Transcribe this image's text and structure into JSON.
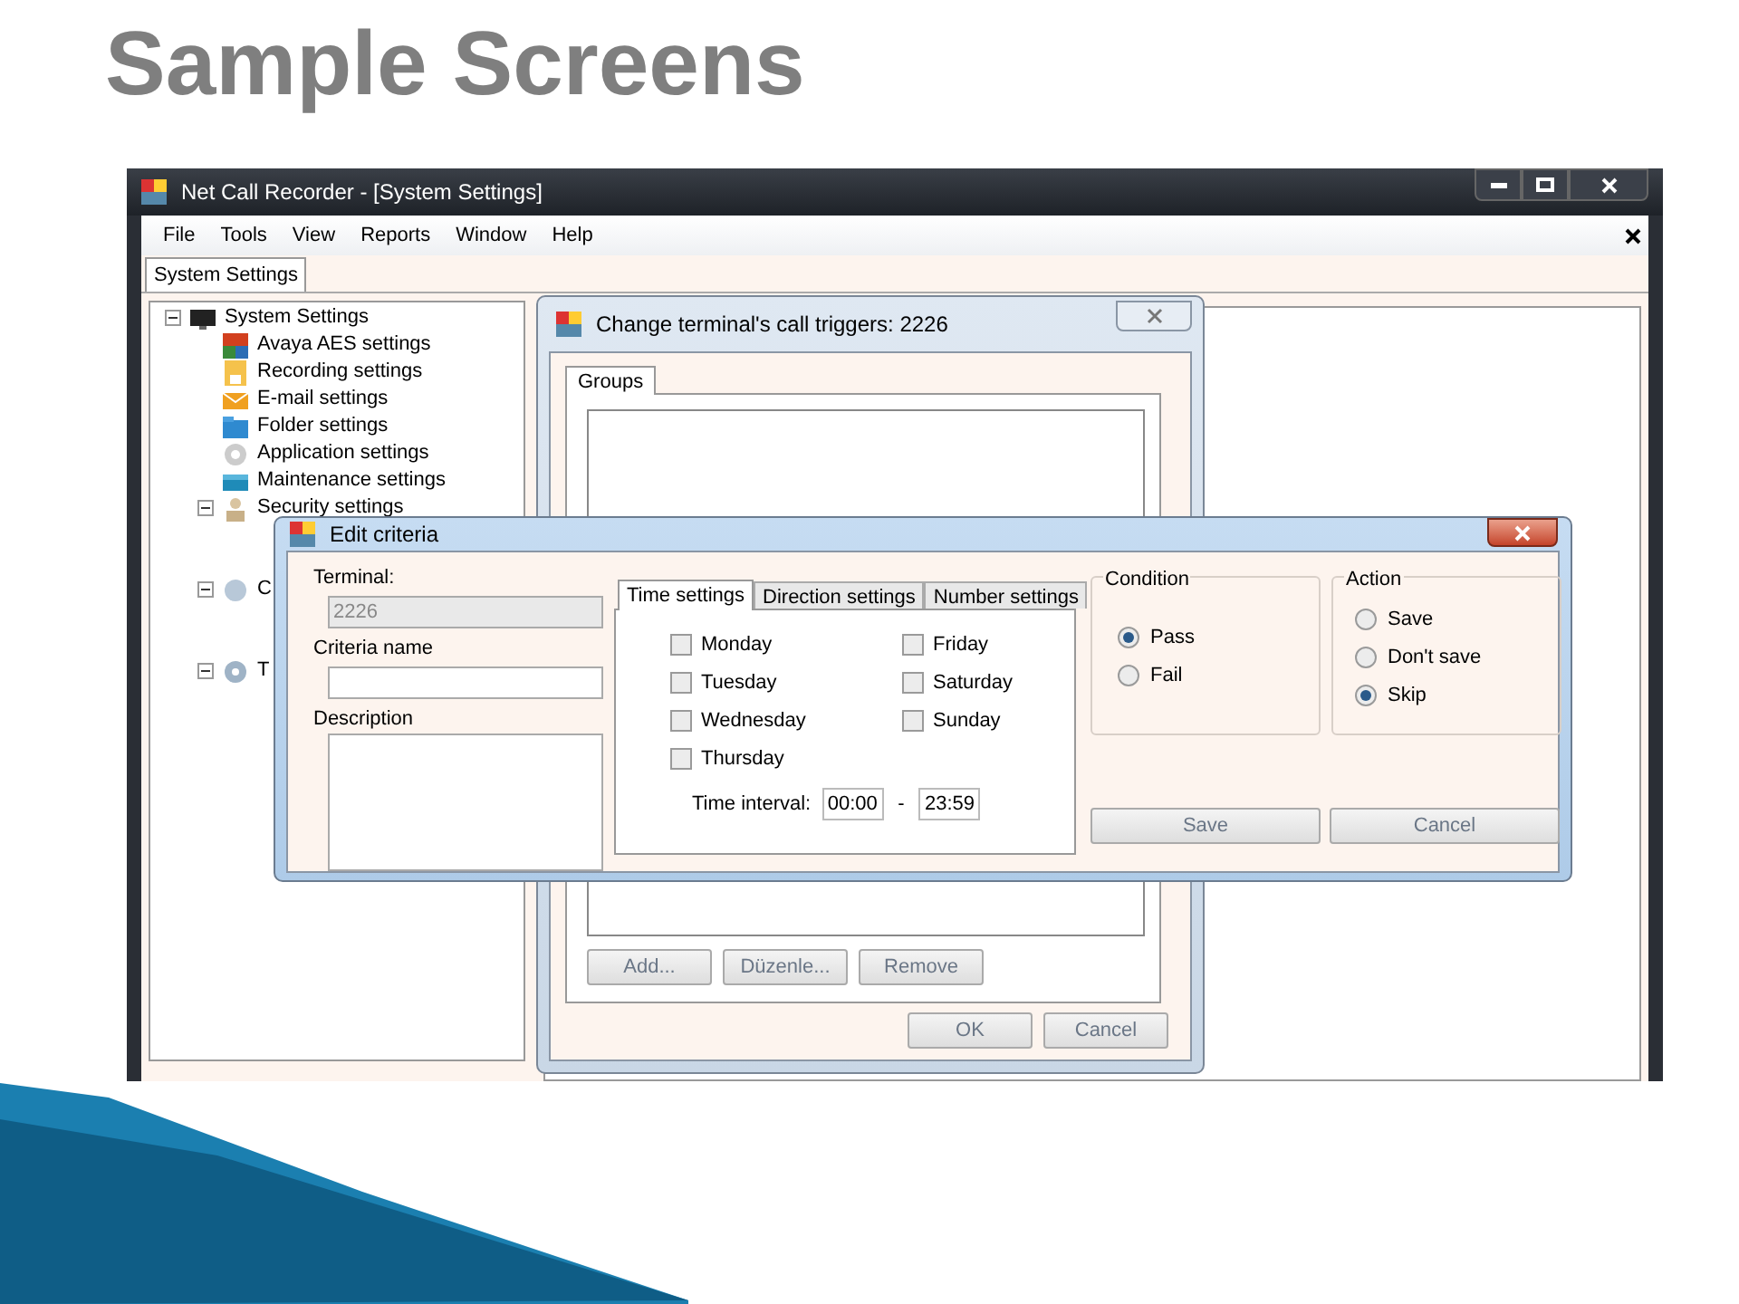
{
  "slide": {
    "title": "Sample Screens"
  },
  "main_window": {
    "title": "Net Call Recorder - [System Settings]",
    "menu": [
      "File",
      "Tools",
      "View",
      "Reports",
      "Window",
      "Help"
    ],
    "document_tabs": [
      {
        "label": "System Settings",
        "selected": true
      }
    ],
    "tree": [
      {
        "label": "System Settings",
        "expanded": true,
        "children": [
          {
            "label": "Avaya AES settings"
          },
          {
            "label": "Recording settings"
          },
          {
            "label": "E-mail settings"
          },
          {
            "label": "Folder settings"
          },
          {
            "label": "Application settings"
          },
          {
            "label": "Maintenance settings"
          },
          {
            "label": "Security settings",
            "expanded": true
          },
          {
            "label": "C",
            "expanded": true
          },
          {
            "label": "T",
            "expanded": true
          }
        ]
      }
    ]
  },
  "triggers_dialog": {
    "title": "Change terminal's call triggers: 2226",
    "tabs": [
      {
        "label": "Groups",
        "selected": true
      }
    ],
    "list_buttons": [
      "Add...",
      "Düzenle...",
      "Remove"
    ],
    "buttons": [
      "OK",
      "Cancel"
    ]
  },
  "criteria_dialog": {
    "title": "Edit criteria",
    "fields": [
      {
        "label": "Terminal:",
        "value": "2226",
        "disabled": true
      },
      {
        "label": "Criteria name",
        "disabled": false
      }
    ],
    "description": {
      "label": "Description"
    },
    "tabs": [
      {
        "label": "Time settings",
        "selected": true
      },
      {
        "label": "Direction settings",
        "selected": false
      },
      {
        "label": "Number settings",
        "selected": false
      }
    ],
    "days": [
      {
        "label": "Monday",
        "checked": false
      },
      {
        "label": "Tuesday",
        "checked": false
      },
      {
        "label": "Wednesday",
        "checked": false
      },
      {
        "label": "Thursday",
        "checked": false
      },
      {
        "label": "Friday",
        "checked": false
      },
      {
        "label": "Saturday",
        "checked": false
      },
      {
        "label": "Sunday",
        "checked": false
      }
    ],
    "time_interval": {
      "label": "Time interval:",
      "from": "00:00",
      "separator": "-",
      "to": "23:59"
    },
    "groups": [
      {
        "title": "Condition",
        "options": [
          {
            "label": "Pass",
            "selected": true
          },
          {
            "label": "Fail",
            "selected": false
          }
        ]
      },
      {
        "title": "Action",
        "options": [
          {
            "label": "Save",
            "selected": false
          },
          {
            "label": "Don't save",
            "selected": false
          },
          {
            "label": "Skip",
            "selected": true
          }
        ]
      }
    ],
    "buttons": [
      "Save",
      "Cancel"
    ]
  }
}
